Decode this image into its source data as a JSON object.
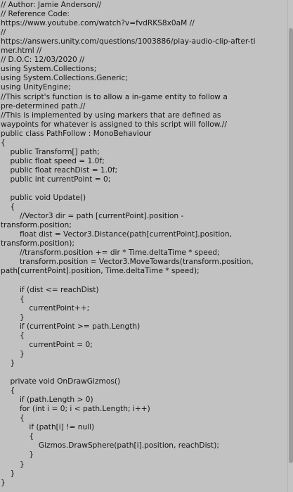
{
  "editor": {
    "lines": [
      "// Author: Jamie Anderson//",
      "// Reference Code:",
      "https://www.youtube.com/watch?v=fvdRKS8x0aM //",
      "//",
      "https://answers.unity.com/questions/1003886/play-audio-clip-after-ti",
      "mer.html //",
      "// D.O.C: 12/03/2020 //",
      "using System.Collections;",
      "using System.Collections.Generic;",
      "using UnityEngine;",
      "//This script's function is to allow a in-game entity to follow a",
      "pre-determined path.//",
      "//This is implemented by using markers that are defined as",
      "waypoints for whatever is assigned to this script will follow.//",
      "public class PathFollow : MonoBehaviour",
      "{",
      "    public Transform[] path;",
      "    public float speed = 1.0f;",
      "    public float reachDist = 1.0f;",
      "    public int currentPoint = 0;",
      "",
      "    public void Update()",
      "    {",
      "        //Vector3 dir = path [currentPoint].position -",
      "transform.position;",
      "        float dist = Vector3.Distance(path[currentPoint].position,",
      "transform.position);",
      "        //transform.position += dir * Time.deltaTime * speed;",
      "        transform.position = Vector3.MoveTowards(transform.position,",
      "path[currentPoint].position, Time.deltaTime * speed);",
      "",
      "        if (dist <= reachDist)",
      "        {",
      "            currentPoint++;",
      "        }",
      "        if (currentPoint >= path.Length)",
      "        {",
      "            currentPoint = 0;",
      "        }",
      "    }",
      "",
      "    private void OnDrawGizmos()",
      "    {",
      "        if (path.Length > 0)",
      "        for (int i = 0; i < path.Length; i++)",
      "        {",
      "            if (path[i] != null)",
      "            {",
      "                Gizmos.DrawSphere(path[i].position, reachDist);",
      "            }",
      "        }",
      "    }",
      "}"
    ]
  }
}
